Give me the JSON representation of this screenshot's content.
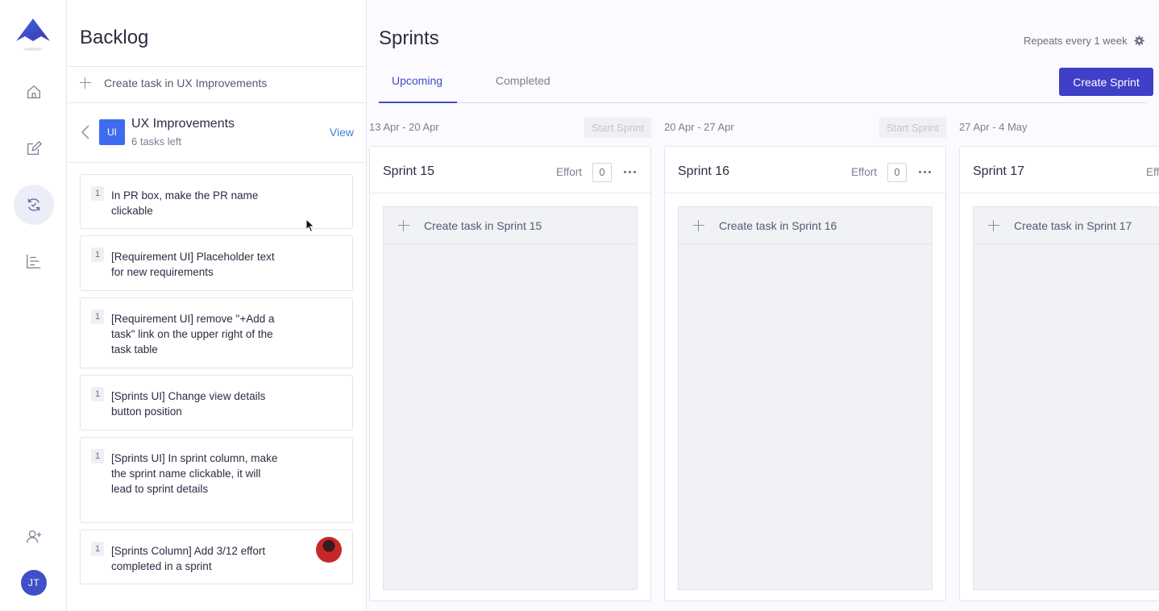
{
  "rail": {
    "items": [
      "home-icon",
      "edit-icon",
      "sprints-icon",
      "roadmap-icon"
    ],
    "active": "sprints-icon",
    "avatar_initials": "JT"
  },
  "backlog": {
    "title": "Backlog",
    "create_task": "Create task in UX Improvements",
    "epic": {
      "badge": "UI",
      "name": "UX Improvements",
      "tasks_left": "6 tasks left",
      "view_label": "View"
    },
    "tasks": [
      {
        "effort": "1",
        "text": "In PR box, make the PR name clickable"
      },
      {
        "effort": "1",
        "text": "[Requirement UI] Placeholder text for new requirements"
      },
      {
        "effort": "1",
        "text": "[Requirement UI] remove \"+Add a task\" link on the upper right of the task table"
      },
      {
        "effort": "1",
        "text": "[Sprints UI] Change view details button position"
      },
      {
        "effort": "1",
        "text": "[Sprints UI] In sprint column, make the sprint name clickable, it will lead to sprint details"
      },
      {
        "effort": "1",
        "text": "[Sprints Column] Add 3/12 effort completed in a sprint"
      }
    ]
  },
  "sprints": {
    "title": "Sprints",
    "repeats": "Repeats every 1 week",
    "tabs": {
      "upcoming": "Upcoming",
      "completed": "Completed"
    },
    "create_sprint": "Create Sprint",
    "start_label": "Start Sprint",
    "effort_label": "Effort",
    "columns": [
      {
        "dates": "13 Apr - 20 Apr",
        "name": "Sprint 15",
        "effort": "0",
        "create": "Create task in Sprint 15"
      },
      {
        "dates": "20 Apr - 27 Apr",
        "name": "Sprint 16",
        "effort": "0",
        "create": "Create task in Sprint 16"
      },
      {
        "dates": "27 Apr - 4 May",
        "name": "Sprint 17",
        "effort": "",
        "create": "Create task in Sprint 17"
      }
    ],
    "col3_effort_partial": "Eff"
  },
  "colors": {
    "primary": "#3f3fc8",
    "accent_link": "#3a86d9",
    "epic_badge": "#3d6cf0"
  }
}
